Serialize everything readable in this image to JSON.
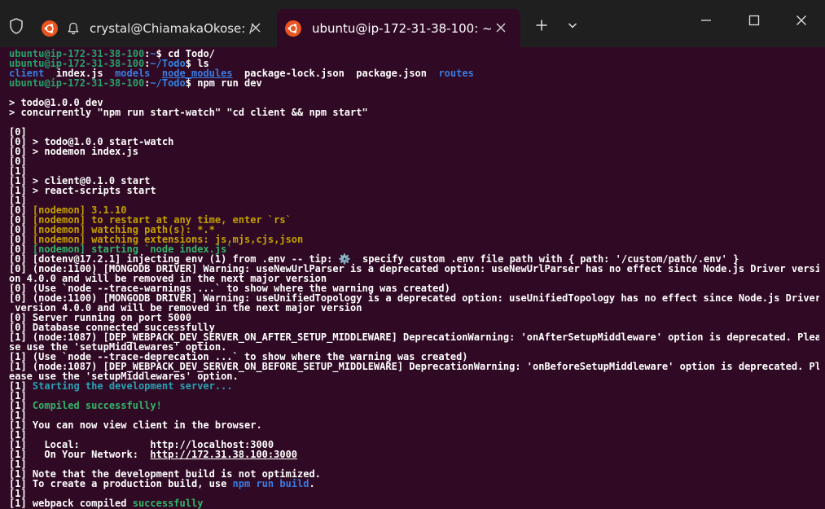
{
  "tabs": [
    {
      "title": "crystal@ChiamakaOkose: /"
    },
    {
      "title": "ubuntu@ip-172-31-38-100: ~"
    }
  ],
  "icons": {
    "shield": "shield-icon",
    "ubuntu": "ubuntu-logo-icon",
    "bell": "bell-icon",
    "close": "close-icon",
    "plus": "plus-icon",
    "chevron": "chevron-down-icon",
    "minimize": "minimize-icon",
    "maximize": "maximize-icon",
    "window_close": "window-close-icon"
  },
  "colors": {
    "terminal_bg": "#300a24",
    "titlebar_bg": "#1f1f1f",
    "prompt_green": "#26a269",
    "path_blue": "#3584e4",
    "nodemon_yellow": "#c4a000",
    "success_green": "#33b56a",
    "info_cyan": "#2aa1b3"
  },
  "terminal": {
    "lines": [
      [
        [
          "ubuntu@ip-172-31-38-100",
          "prompt"
        ],
        [
          ":",
          "white"
        ],
        [
          "~",
          "path"
        ],
        [
          "$ cd Todo/",
          "white"
        ]
      ],
      [
        [
          "ubuntu@ip-172-31-38-100",
          "prompt"
        ],
        [
          ":",
          "white"
        ],
        [
          "~/Todo",
          "path"
        ],
        [
          "$ ls",
          "white"
        ]
      ],
      [
        [
          "client",
          "dir"
        ],
        [
          "  index.js  ",
          "white"
        ],
        [
          "models",
          "dir"
        ],
        [
          "  ",
          "white"
        ],
        [
          "node_modules",
          "dir-u"
        ],
        [
          "  package-lock.json  package.json  ",
          "white"
        ],
        [
          "routes",
          "dir"
        ]
      ],
      [
        [
          "ubuntu@ip-172-31-38-100",
          "prompt"
        ],
        [
          ":",
          "white"
        ],
        [
          "~/Todo",
          "path"
        ],
        [
          "$ npm run dev",
          "white"
        ]
      ],
      [],
      [
        [
          "> todo@1.0.0 dev",
          "white"
        ]
      ],
      [
        [
          "> concurrently \"npm run start-watch\" \"cd client && npm start\"",
          "white"
        ]
      ],
      [],
      [
        [
          "[0]",
          "white"
        ]
      ],
      [
        [
          "[0] > todo@1.0.0 start-watch",
          "white"
        ]
      ],
      [
        [
          "[0] > nodemon index.js",
          "white"
        ]
      ],
      [
        [
          "[0]",
          "white"
        ]
      ],
      [
        [
          "[1]",
          "white"
        ]
      ],
      [
        [
          "[1] > client@0.1.0 start",
          "white"
        ]
      ],
      [
        [
          "[1] > react-scripts start",
          "white"
        ]
      ],
      [
        [
          "[1]",
          "white"
        ]
      ],
      [
        [
          "[0] ",
          "white"
        ],
        [
          "[nodemon] 3.1.10",
          "yellow"
        ]
      ],
      [
        [
          "[0] ",
          "white"
        ],
        [
          "[nodemon] to restart at any time, enter `rs`",
          "yellow"
        ]
      ],
      [
        [
          "[0] ",
          "white"
        ],
        [
          "[nodemon] watching path(s): *.*",
          "yellow"
        ]
      ],
      [
        [
          "[0] ",
          "white"
        ],
        [
          "[nodemon] watching extensions: js,mjs,cjs,json",
          "yellow"
        ]
      ],
      [
        [
          "[0] ",
          "white"
        ],
        [
          "[nodemon] starting `node index.js`",
          "green"
        ]
      ],
      [
        [
          "[0] [dotenv@17.2.1] injecting env (1) from .env -- tip: ⚙️  specify custom .env file path with { path: '/custom/path/.env' }",
          "white"
        ]
      ],
      [
        [
          "[0] (node:1100) [MONGODB DRIVER] Warning: useNewUrlParser is a deprecated option: useNewUrlParser has no effect since Node.js Driver versi",
          "white"
        ]
      ],
      [
        [
          "on 4.0.0 and will be removed in the next major version",
          "white"
        ]
      ],
      [
        [
          "[0] (Use `node --trace-warnings ...` to show where the warning was created)",
          "white"
        ]
      ],
      [
        [
          "[0] (node:1100) [MONGODB DRIVER] Warning: useUnifiedTopology is a deprecated option: useUnifiedTopology has no effect since Node.js Driver",
          "white"
        ]
      ],
      [
        [
          " version 4.0.0 and will be removed in the next major version",
          "white"
        ]
      ],
      [
        [
          "[0] Server running on port 5000",
          "white"
        ]
      ],
      [
        [
          "[0] Database connected successfully",
          "white"
        ]
      ],
      [
        [
          "[1] (node:1087) [DEP_WEBPACK_DEV_SERVER_ON_AFTER_SETUP_MIDDLEWARE] DeprecationWarning: 'onAfterSetupMiddleware' option is deprecated. Plea",
          "white"
        ]
      ],
      [
        [
          "se use the 'setupMiddlewares' option.",
          "white"
        ]
      ],
      [
        [
          "[1] (Use `node --trace-deprecation ...` to show where the warning was created)",
          "white"
        ]
      ],
      [
        [
          "[1] (node:1087) [DEP_WEBPACK_DEV_SERVER_ON_BEFORE_SETUP_MIDDLEWARE] DeprecationWarning: 'onBeforeSetupMiddleware' option is deprecated. Pl",
          "white"
        ]
      ],
      [
        [
          "ease use the 'setupMiddlewares' option.",
          "white"
        ]
      ],
      [
        [
          "[1] ",
          "white"
        ],
        [
          "Starting the development server...",
          "cyan"
        ]
      ],
      [
        [
          "[1]",
          "white"
        ]
      ],
      [
        [
          "[1] ",
          "white"
        ],
        [
          "Compiled successfully!",
          "green"
        ]
      ],
      [
        [
          "[1]",
          "white"
        ]
      ],
      [
        [
          "[1] You can now view ",
          "white"
        ],
        [
          "client",
          "white"
        ],
        [
          " in the browser.",
          "white"
        ]
      ],
      [
        [
          "[1]",
          "white"
        ]
      ],
      [
        [
          "[1]   ",
          "white"
        ],
        [
          "Local:",
          "white"
        ],
        [
          "            http://localhost:",
          "white"
        ],
        [
          "3000",
          "white"
        ]
      ],
      [
        [
          "[1]   ",
          "white"
        ],
        [
          "On Your Network:",
          "white"
        ],
        [
          "  ",
          "white"
        ],
        [
          "http://172.31.38.100:3000",
          "white-u"
        ]
      ],
      [
        [
          "[1]",
          "white"
        ]
      ],
      [
        [
          "[1] Note that the development build is not optimized.",
          "white"
        ]
      ],
      [
        [
          "[1] To create a production build, use ",
          "white"
        ],
        [
          "npm run build",
          "blue"
        ],
        [
          ".",
          "white"
        ]
      ],
      [
        [
          "[1]",
          "white"
        ]
      ],
      [
        [
          "[1] webpack compiled ",
          "white"
        ],
        [
          "successfully",
          "green"
        ]
      ]
    ]
  }
}
